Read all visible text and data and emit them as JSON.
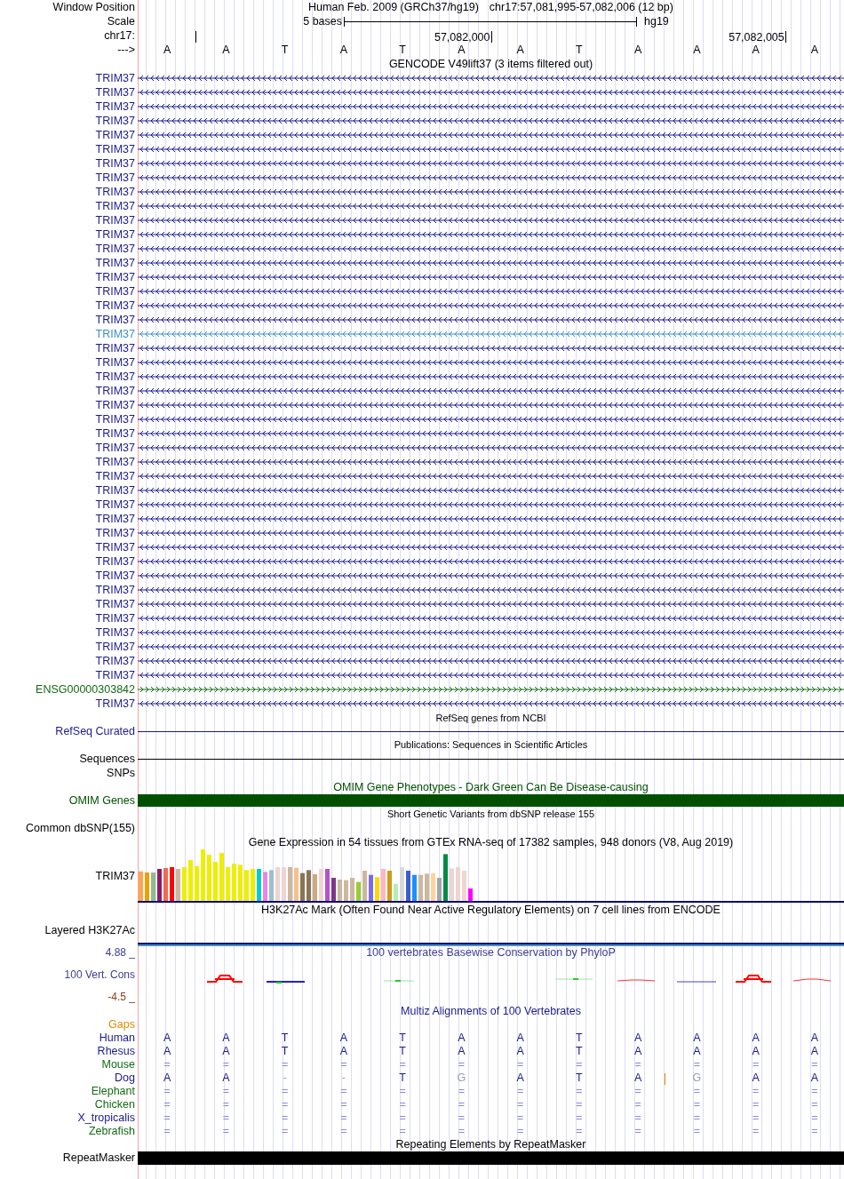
{
  "header": {
    "label": "Window Position",
    "assembly": "Human Feb. 2009 (GRCh37/hg19)",
    "position": "chr17:57,081,995-57,082,006 (12 bp)"
  },
  "scale": {
    "label": "Scale",
    "span": "5 bases",
    "genome": "hg19"
  },
  "ruler": {
    "label": "chr17:",
    "ticks": [
      "57,082,000",
      "57,082,005"
    ]
  },
  "bases": {
    "label": "--->",
    "letters": [
      "A",
      "A",
      "T",
      "A",
      "T",
      "A",
      "A",
      "T",
      "A",
      "A",
      "A",
      "A"
    ]
  },
  "gencode": {
    "title": "GENCODE V49lift37 (3 items filtered out)",
    "items": [
      {
        "name": "TRIM37",
        "kind": "reverse",
        "color": "#1a1a8c"
      },
      {
        "name": "TRIM37",
        "kind": "reverse",
        "color": "#1a1a8c"
      },
      {
        "name": "TRIM37",
        "kind": "reverse",
        "color": "#1a1a8c"
      },
      {
        "name": "TRIM37",
        "kind": "reverse",
        "color": "#1a1a8c"
      },
      {
        "name": "TRIM37",
        "kind": "reverse",
        "color": "#1a1a8c"
      },
      {
        "name": "TRIM37",
        "kind": "reverse",
        "color": "#1a1a8c"
      },
      {
        "name": "TRIM37",
        "kind": "reverse",
        "color": "#1a1a8c"
      },
      {
        "name": "TRIM37",
        "kind": "reverse",
        "color": "#1a1a8c"
      },
      {
        "name": "TRIM37",
        "kind": "reverse",
        "color": "#1a1a8c"
      },
      {
        "name": "TRIM37",
        "kind": "reverse",
        "color": "#1a1a8c"
      },
      {
        "name": "TRIM37",
        "kind": "reverse",
        "color": "#1a1a8c"
      },
      {
        "name": "TRIM37",
        "kind": "reverse",
        "color": "#1a1a8c"
      },
      {
        "name": "TRIM37",
        "kind": "reverse",
        "color": "#1a1a8c"
      },
      {
        "name": "TRIM37",
        "kind": "reverse",
        "color": "#1a1a8c"
      },
      {
        "name": "TRIM37",
        "kind": "reverse",
        "color": "#1a1a8c"
      },
      {
        "name": "TRIM37",
        "kind": "reverse",
        "color": "#1a1a8c"
      },
      {
        "name": "TRIM37",
        "kind": "reverse",
        "color": "#1a1a8c"
      },
      {
        "name": "TRIM37",
        "kind": "reverse",
        "color": "#1a1a8c"
      },
      {
        "name": "TRIM37",
        "kind": "reverse",
        "color": "#3d8fc4"
      },
      {
        "name": "TRIM37",
        "kind": "reverse",
        "color": "#1a1a8c"
      },
      {
        "name": "TRIM37",
        "kind": "reverse",
        "color": "#1a1a8c"
      },
      {
        "name": "TRIM37",
        "kind": "reverse",
        "color": "#1a1a8c"
      },
      {
        "name": "TRIM37",
        "kind": "reverse",
        "color": "#1a1a8c"
      },
      {
        "name": "TRIM37",
        "kind": "reverse",
        "color": "#1a1a8c"
      },
      {
        "name": "TRIM37",
        "kind": "reverse",
        "color": "#1a1a8c"
      },
      {
        "name": "TRIM37",
        "kind": "reverse",
        "color": "#1a1a8c"
      },
      {
        "name": "TRIM37",
        "kind": "reverse",
        "color": "#1a1a8c"
      },
      {
        "name": "TRIM37",
        "kind": "reverse",
        "color": "#1a1a8c"
      },
      {
        "name": "TRIM37",
        "kind": "reverse",
        "color": "#1a1a8c"
      },
      {
        "name": "TRIM37",
        "kind": "reverse",
        "color": "#1a1a8c"
      },
      {
        "name": "TRIM37",
        "kind": "reverse",
        "color": "#1a1a8c"
      },
      {
        "name": "TRIM37",
        "kind": "reverse",
        "color": "#1a1a8c"
      },
      {
        "name": "TRIM37",
        "kind": "reverse",
        "color": "#1a1a8c"
      },
      {
        "name": "TRIM37",
        "kind": "reverse",
        "color": "#1a1a8c"
      },
      {
        "name": "TRIM37",
        "kind": "reverse",
        "color": "#1a1a8c"
      },
      {
        "name": "TRIM37",
        "kind": "reverse",
        "color": "#1a1a8c"
      },
      {
        "name": "TRIM37",
        "kind": "reverse",
        "color": "#1a1a8c"
      },
      {
        "name": "TRIM37",
        "kind": "reverse",
        "color": "#1a1a8c"
      },
      {
        "name": "TRIM37",
        "kind": "reverse",
        "color": "#1a1a8c"
      },
      {
        "name": "TRIM37",
        "kind": "reverse",
        "color": "#1a1a8c"
      },
      {
        "name": "TRIM37",
        "kind": "reverse",
        "color": "#1a1a8c"
      },
      {
        "name": "TRIM37",
        "kind": "reverse",
        "color": "#1a1a8c"
      },
      {
        "name": "TRIM37",
        "kind": "reverse",
        "color": "#1a1a8c"
      },
      {
        "name": "ENSG00000303842",
        "kind": "forward",
        "color": "#136b13"
      },
      {
        "name": "TRIM37",
        "kind": "reverse",
        "color": "#1a1a8c"
      }
    ]
  },
  "tracks": [
    {
      "kind": "line",
      "title": "RefSeq genes from NCBI",
      "labels": [
        "RefSeq Curated"
      ],
      "color": "#1a1a8c"
    },
    {
      "kind": "line",
      "title": "Publications: Sequences in Scientific Articles",
      "labels": [
        "Sequences",
        "SNPs"
      ],
      "color": "#000000"
    },
    {
      "kind": "bar",
      "title": "OMIM Gene Phenotypes - Dark Green Can Be Disease-causing",
      "labels": [
        "OMIM Genes"
      ],
      "color": "#005000"
    },
    {
      "kind": "empty",
      "title": "Short Genetic Variants from dbSNP release 155",
      "labels": [
        "Common dbSNP(155)"
      ],
      "color": "#000000"
    },
    {
      "kind": "expression",
      "title": "Gene Expression in 54 tissues from GTEx RNA-seq of 17382 samples, 948 donors (V8, Aug 2019)",
      "labels": [
        "TRIM37"
      ],
      "color": "#000000"
    },
    {
      "kind": "signal",
      "title": "H3K27Ac Mark (Often Found Near Active Regulatory Elements) on 7 cell lines from ENCODE",
      "labels": [
        "Layered H3K27Ac"
      ],
      "color": "#000000"
    },
    {
      "kind": "conservation",
      "title": "100 vertebrates Basewise Conservation by PhyloP",
      "labels": [
        "4.88 _",
        "100 Vert. Cons",
        "-4.5 _"
      ],
      "color": "#3c3c96"
    }
  ],
  "multiz": {
    "title": "Multiz Alignments of 100 Vertebrates",
    "species": [
      {
        "name": "Gaps",
        "kind": "gaps",
        "color": "#e08a00"
      },
      {
        "name": "Human",
        "kind": "bases",
        "color": "#1a1a8c",
        "bases": [
          {
            "base": "A",
            "mismatch": false
          },
          {
            "base": "A",
            "mismatch": false
          },
          {
            "base": "T",
            "mismatch": false
          },
          {
            "base": "A",
            "mismatch": false
          },
          {
            "base": "T",
            "mismatch": false
          },
          {
            "base": "A",
            "mismatch": false
          },
          {
            "base": "A",
            "mismatch": false
          },
          {
            "base": "T",
            "mismatch": false
          },
          {
            "base": "A",
            "mismatch": false
          },
          {
            "base": "A",
            "mismatch": false
          },
          {
            "base": "A",
            "mismatch": false
          },
          {
            "base": "A",
            "mismatch": false
          }
        ]
      },
      {
        "name": "Rhesus",
        "kind": "bases",
        "color": "#1a1a8c",
        "bases": [
          {
            "base": "A",
            "mismatch": false
          },
          {
            "base": "A",
            "mismatch": false
          },
          {
            "base": "T",
            "mismatch": false
          },
          {
            "base": "A",
            "mismatch": false
          },
          {
            "base": "T",
            "mismatch": false
          },
          {
            "base": "A",
            "mismatch": false
          },
          {
            "base": "A",
            "mismatch": false
          },
          {
            "base": "T",
            "mismatch": false
          },
          {
            "base": "A",
            "mismatch": false
          },
          {
            "base": "A",
            "mismatch": false
          },
          {
            "base": "A",
            "mismatch": false
          },
          {
            "base": "A",
            "mismatch": false
          }
        ]
      },
      {
        "name": "Mouse",
        "kind": "identical",
        "color": "#136b13",
        "bases": [
          {
            "base": "=",
            "mismatch": false
          },
          {
            "base": "=",
            "mismatch": false
          },
          {
            "base": "=",
            "mismatch": false
          },
          {
            "base": "=",
            "mismatch": false
          },
          {
            "base": "=",
            "mismatch": false
          },
          {
            "base": "=",
            "mismatch": false
          },
          {
            "base": "=",
            "mismatch": false
          },
          {
            "base": "=",
            "mismatch": false
          },
          {
            "base": "=",
            "mismatch": false
          },
          {
            "base": "=",
            "mismatch": false
          },
          {
            "base": "=",
            "mismatch": false
          },
          {
            "base": "=",
            "mismatch": false
          }
        ]
      },
      {
        "name": "Dog",
        "kind": "bases",
        "color": "#1a1a8c",
        "bases": [
          {
            "base": "A",
            "mismatch": false
          },
          {
            "base": "A",
            "mismatch": false
          },
          {
            "base": "-",
            "mismatch": true
          },
          {
            "base": "-",
            "mismatch": true
          },
          {
            "base": "T",
            "mismatch": false
          },
          {
            "base": "G",
            "mismatch": true
          },
          {
            "base": "A",
            "mismatch": false
          },
          {
            "base": "T",
            "mismatch": false
          },
          {
            "base": "A",
            "mismatch": false,
            "insertion": true
          },
          {
            "base": "G",
            "mismatch": true
          },
          {
            "base": "A",
            "mismatch": false
          },
          {
            "base": "A",
            "mismatch": false
          }
        ]
      },
      {
        "name": "Elephant",
        "kind": "identical",
        "color": "#136b13",
        "bases": [
          {
            "base": "=",
            "mismatch": false
          },
          {
            "base": "=",
            "mismatch": false
          },
          {
            "base": "=",
            "mismatch": false
          },
          {
            "base": "=",
            "mismatch": false
          },
          {
            "base": "=",
            "mismatch": false
          },
          {
            "base": "=",
            "mismatch": false
          },
          {
            "base": "=",
            "mismatch": false
          },
          {
            "base": "=",
            "mismatch": false
          },
          {
            "base": "=",
            "mismatch": false
          },
          {
            "base": "=",
            "mismatch": false
          },
          {
            "base": "=",
            "mismatch": false
          },
          {
            "base": "=",
            "mismatch": false
          }
        ]
      },
      {
        "name": "Chicken",
        "kind": "identical",
        "color": "#136b13",
        "bases": [
          {
            "base": "=",
            "mismatch": false
          },
          {
            "base": "=",
            "mismatch": false
          },
          {
            "base": "=",
            "mismatch": false
          },
          {
            "base": "=",
            "mismatch": false
          },
          {
            "base": "=",
            "mismatch": false
          },
          {
            "base": "=",
            "mismatch": false
          },
          {
            "base": "=",
            "mismatch": false
          },
          {
            "base": "=",
            "mismatch": false
          },
          {
            "base": "=",
            "mismatch": false
          },
          {
            "base": "=",
            "mismatch": false
          },
          {
            "base": "=",
            "mismatch": false
          },
          {
            "base": "=",
            "mismatch": false
          }
        ]
      },
      {
        "name": "X_tropicalis",
        "kind": "identical",
        "color": "#1a1a8c",
        "bases": [
          {
            "base": "=",
            "mismatch": false
          },
          {
            "base": "=",
            "mismatch": false
          },
          {
            "base": "=",
            "mismatch": false
          },
          {
            "base": "=",
            "mismatch": false
          },
          {
            "base": "=",
            "mismatch": false
          },
          {
            "base": "=",
            "mismatch": false
          },
          {
            "base": "=",
            "mismatch": false
          },
          {
            "base": "=",
            "mismatch": false
          },
          {
            "base": "=",
            "mismatch": false
          },
          {
            "base": "=",
            "mismatch": false
          },
          {
            "base": "=",
            "mismatch": false
          },
          {
            "base": "=",
            "mismatch": false
          }
        ]
      },
      {
        "name": "Zebrafish",
        "kind": "identical",
        "color": "#136b13",
        "bases": [
          {
            "base": "=",
            "mismatch": false
          },
          {
            "base": "=",
            "mismatch": false
          },
          {
            "base": "=",
            "mismatch": false
          },
          {
            "base": "=",
            "mismatch": false
          },
          {
            "base": "=",
            "mismatch": false
          },
          {
            "base": "=",
            "mismatch": false
          },
          {
            "base": "=",
            "mismatch": false
          },
          {
            "base": "=",
            "mismatch": false
          },
          {
            "base": "=",
            "mismatch": false
          },
          {
            "base": "=",
            "mismatch": false
          },
          {
            "base": "=",
            "mismatch": false
          },
          {
            "base": "=",
            "mismatch": false
          }
        ]
      }
    ]
  },
  "repeats": {
    "title": "Repeating Elements by RepeatMasker",
    "label": "RepeatMasker"
  }
}
